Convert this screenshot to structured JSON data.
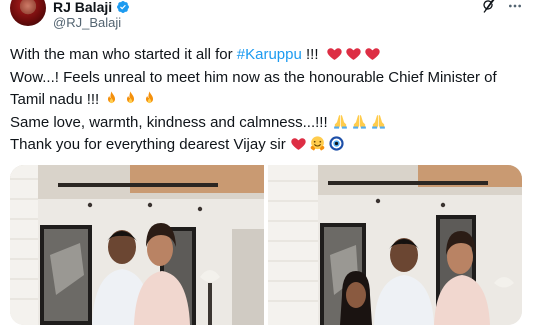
{
  "header": {
    "display_name": "RJ Balaji",
    "handle": "@RJ_Balaji",
    "verified": true,
    "icons": [
      "grok-icon",
      "more-icon",
      "verified-badge-icon"
    ]
  },
  "tweet": {
    "line1_text": "With the man who started it all for ",
    "hashtag": "#Karuppu",
    "line1_suffix": " !!!",
    "line2": "Wow...! Feels unreal to meet him now as the honourable Chief Minister of",
    "line3": "Tamil nadu !!!",
    "line4": "Same love, warmth, kindness and calmness...!!!",
    "line5": "Thank you for everything dearest Vijay sir",
    "emojis": {
      "line1": [
        "red-heart",
        "red-heart",
        "red-heart"
      ],
      "line3": [
        "fire",
        "fire",
        "fire"
      ],
      "line4": [
        "folded-hands",
        "folded-hands",
        "folded-hands"
      ],
      "line5": [
        "red-heart",
        "hugging-face",
        "nazar-amulet"
      ]
    }
  },
  "media": {
    "photo_count": 2
  },
  "colors": {
    "text": "#0f1419",
    "secondary": "#536471",
    "link": "#1d9bf0",
    "verified": "#1d9bf0",
    "heart": "#f91880"
  }
}
